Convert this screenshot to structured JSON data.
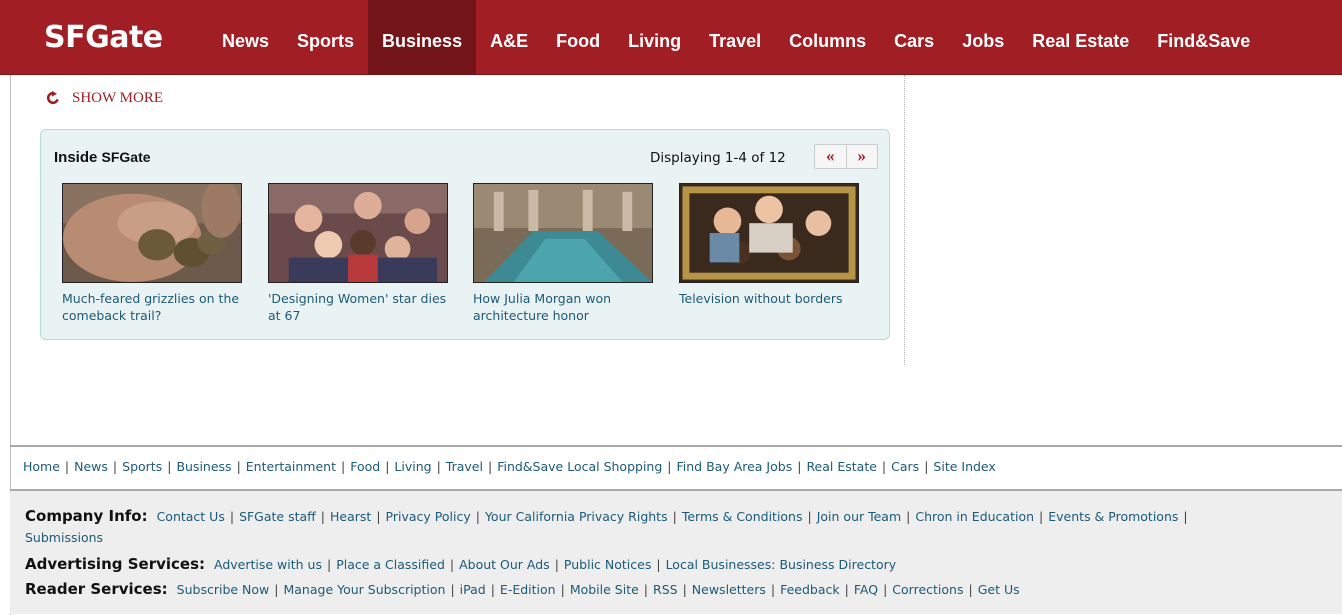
{
  "nav": {
    "logo": "SFGate",
    "items": [
      {
        "label": "News"
      },
      {
        "label": "Sports"
      },
      {
        "label": "Business",
        "active": true
      },
      {
        "label": "A&E"
      },
      {
        "label": "Food"
      },
      {
        "label": "Living"
      },
      {
        "label": "Travel"
      },
      {
        "label": "Columns"
      },
      {
        "label": "Cars"
      },
      {
        "label": "Jobs"
      },
      {
        "label": "Real Estate"
      },
      {
        "label": "Find&Save"
      }
    ]
  },
  "show_more": {
    "label": "SHOW MORE",
    "icon": "refresh-icon"
  },
  "inside": {
    "title_prefix": "Inside",
    "title_brand": "SFGate",
    "displaying": "Displaying 1-4 of 12",
    "prev": "«",
    "next": "»",
    "items": [
      {
        "caption": "Much-feared grizzlies on the comeback trail?"
      },
      {
        "caption": "'Designing Women' star dies at 67"
      },
      {
        "caption": "How Julia Morgan won architecture honor"
      },
      {
        "caption": "Television without borders"
      }
    ]
  },
  "footer": {
    "links": [
      "Home",
      "News",
      "Sports",
      "Business",
      "Entertainment",
      "Food",
      "Living",
      "Travel",
      "Find&Save Local Shopping",
      "Find Bay Area Jobs",
      "Real Estate",
      "Cars",
      "Site Index"
    ],
    "company": {
      "label": "Company Info:",
      "links": [
        "Contact Us",
        "SFGate staff",
        "Hearst",
        "Privacy Policy",
        "Your California Privacy Rights",
        "Terms & Conditions",
        "Join our Team",
        "Chron in Education",
        "Events & Promotions"
      ],
      "overflow": "Submissions"
    },
    "advertising": {
      "label": "Advertising Services:",
      "links": [
        "Advertise with us",
        "Place a Classified",
        "About Our Ads",
        "Public Notices",
        "Local Businesses: Business Directory"
      ]
    },
    "reader": {
      "label": "Reader Services:",
      "links": [
        "Subscribe Now",
        "Manage Your Subscription",
        "iPad",
        "E-Edition",
        "Mobile Site",
        "RSS",
        "Newsletters",
        "Feedback",
        "FAQ",
        "Corrections",
        "Get Us"
      ]
    }
  },
  "colors": {
    "brand": "#a01e24",
    "active_nav": "#731519",
    "link": "#1c5a78",
    "panel": "#eaf3f3"
  }
}
